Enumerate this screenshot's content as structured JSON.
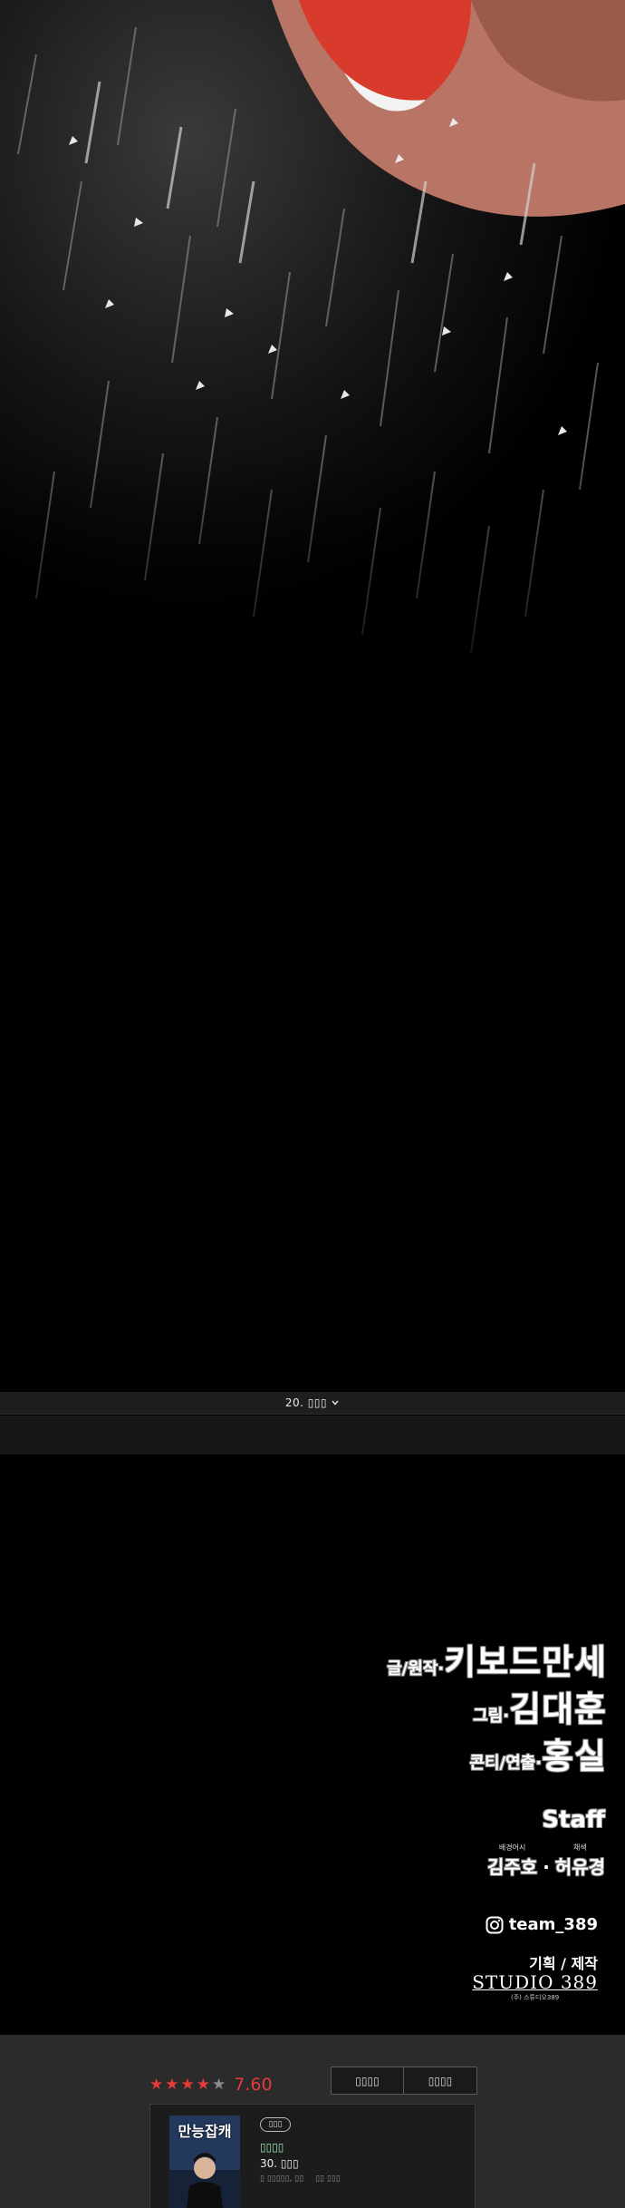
{
  "episode_bar": {
    "label": "20. ▯▯▯",
    "icon": "chevron-down-icon"
  },
  "credits": {
    "writer": {
      "role": "글/원작·",
      "name": "키보드만세"
    },
    "artist": {
      "role": "그림·",
      "name": "김대훈"
    },
    "director": {
      "role": "콘티/연출·",
      "name": "홍실"
    },
    "staff_title": "Staff",
    "staff": [
      {
        "small": "배경어시",
        "name": "김주호"
      },
      {
        "small": "채색",
        "name": "허유경"
      }
    ],
    "staff_separator": "·",
    "instagram": {
      "icon": "instagram-icon",
      "handle": "team_389"
    },
    "planning_label": "기획 / 제작",
    "studio_name": "STUDIO 389",
    "studio_sub": "(주) 스튜디오389"
  },
  "info": {
    "rating": {
      "stars_filled": 4,
      "stars_total": 5,
      "value": "7.60",
      "color": "#e53b3b"
    },
    "buttons": [
      {
        "label": "▯▯▯▯"
      },
      {
        "label": "▯▯▯▯"
      }
    ],
    "card": {
      "thumb_title": "만능잡캐",
      "tag": "▯▯▯",
      "title": "▯▯▯▯",
      "episode": "30. ▯▯▯",
      "meta_left": "▯ ▯▯▯▯▯, ▯▯",
      "meta_right": "▯▯ ▯▯▯"
    }
  }
}
